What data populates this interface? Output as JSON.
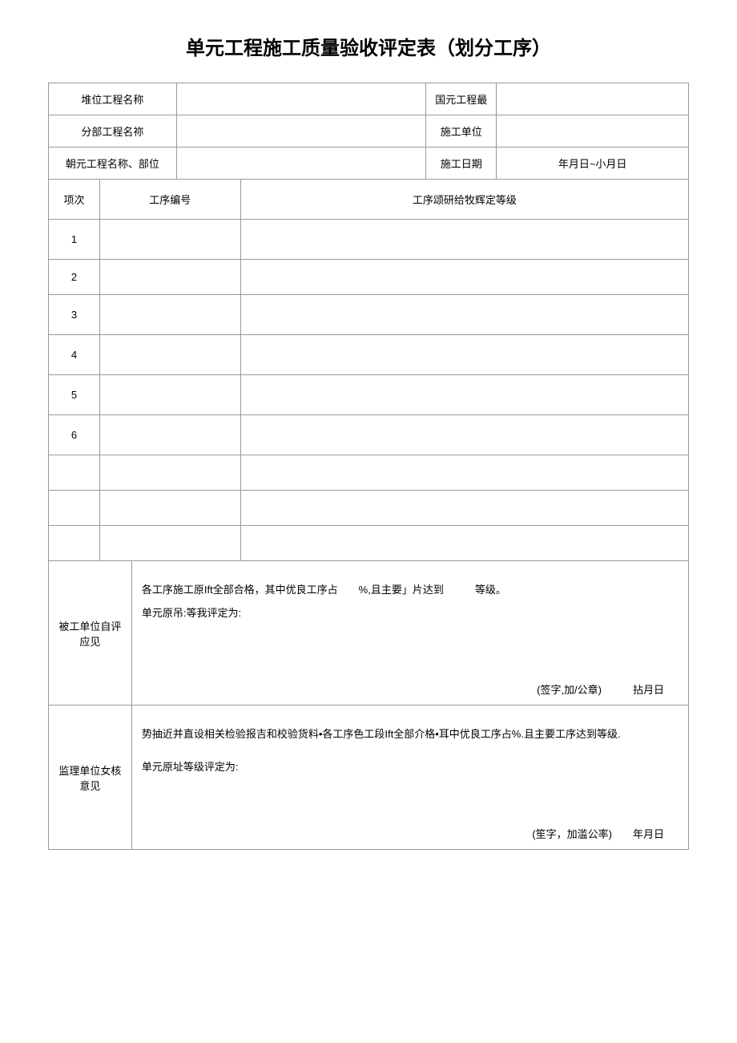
{
  "title": "单元工程施工质量验收评定表（划分工序）",
  "header": {
    "row1": {
      "label": "堆位工程名称",
      "rlabel": "国元工程最",
      "val1": "",
      "val2": ""
    },
    "row2": {
      "label": "分部工程名祢",
      "rlabel": "施工单位",
      "val1": "",
      "val2": ""
    },
    "row3": {
      "label": "朝元工程名称、部位",
      "rlabel": "施工日期",
      "val1": "",
      "val2": "年月日~小月日"
    }
  },
  "columns": {
    "seq": "项次",
    "code": "工序编号",
    "grade": "工序颂研给牧辉定等级"
  },
  "rows": [
    {
      "seq": "1",
      "code": "",
      "grade": ""
    },
    {
      "seq": "2",
      "code": "",
      "grade": ""
    },
    {
      "seq": "3",
      "code": "",
      "grade": ""
    },
    {
      "seq": "4",
      "code": "",
      "grade": ""
    },
    {
      "seq": "5",
      "code": "",
      "grade": ""
    },
    {
      "seq": "6",
      "code": "",
      "grade": ""
    },
    {
      "seq": "",
      "code": "",
      "grade": ""
    },
    {
      "seq": "",
      "code": "",
      "grade": ""
    },
    {
      "seq": "",
      "code": "",
      "grade": ""
    }
  ],
  "review": {
    "self": {
      "label": "被工单位自评应见",
      "line1": "各工序施工原Ift全部合格，其中优良工序占  %,且主要」片达到   等级。",
      "line2": "单元原吊:等我评定为:",
      "footer": "(签字,加/公章)   拈月日"
    },
    "super": {
      "label": "监理单位女核意见",
      "line1": "势抽近并直设相关检验报吉和校验货料•各工序色工段Ift全部介格•耳中优良工序占%.且主要工序达到等级.",
      "line2": "单元原址等级评定为:",
      "footer": "(笙字，加滥公率)  年月日"
    }
  }
}
